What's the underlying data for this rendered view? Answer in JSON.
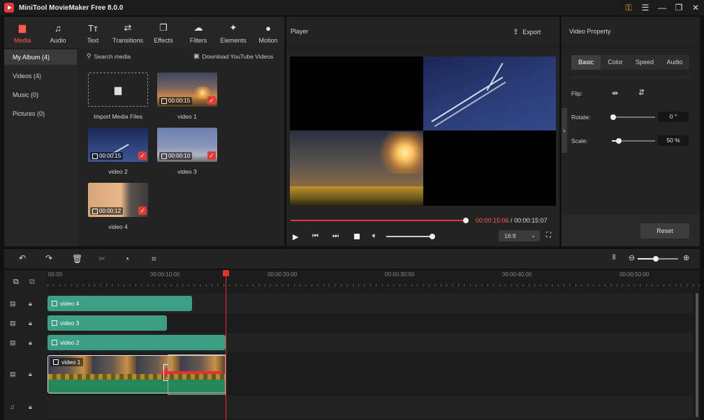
{
  "app": {
    "title": "MiniTool MovieMaker Free 8.0.0"
  },
  "toolbar": {
    "tabs": [
      {
        "label": "Media",
        "icon": "folder-icon",
        "glyph": "▆"
      },
      {
        "label": "Audio",
        "icon": "music-icon",
        "glyph": "♫"
      },
      {
        "label": "Text",
        "icon": "text-icon",
        "glyph": "Tт"
      },
      {
        "label": "Transitions",
        "icon": "transitions-icon",
        "glyph": "⇄"
      },
      {
        "label": "Effects",
        "icon": "effects-icon",
        "glyph": "❐"
      },
      {
        "label": "Filters",
        "icon": "filters-icon",
        "glyph": "☁"
      },
      {
        "label": "Elements",
        "icon": "elements-icon",
        "glyph": "✦"
      },
      {
        "label": "Motion",
        "icon": "motion-icon",
        "glyph": "●"
      }
    ]
  },
  "sidebar": {
    "items": [
      {
        "label": "My Album  (4)"
      },
      {
        "label": "Videos  (4)"
      },
      {
        "label": "Music  (0)"
      },
      {
        "label": "Pictures  (0)"
      }
    ]
  },
  "media": {
    "search_placeholder": "Search media",
    "download_label": "Download YouTube Videos",
    "import_label": "Import Media Files",
    "items": [
      {
        "name": "video 1",
        "duration": "00:00:15"
      },
      {
        "name": "video 2",
        "duration": "00:00:15"
      },
      {
        "name": "video 3",
        "duration": "00:00:10"
      },
      {
        "name": "video 4",
        "duration": "00:00:12"
      }
    ]
  },
  "player": {
    "title": "Player",
    "export_label": "Export",
    "current_time": "00:00:15:06",
    "separator": " / ",
    "total_time": "00:00:15:07",
    "aspect": "16:9",
    "progress": 1.0,
    "volume": 0.97
  },
  "properties": {
    "title": "Video Property",
    "tabs": [
      "Basic",
      "Color",
      "Speed",
      "Audio"
    ],
    "flip_label": "Flip:",
    "rotate_label": "Rotate:",
    "rotate_value": "0 °",
    "scale_label": "Scale:",
    "scale_value": "50 %",
    "reset_label": "Reset"
  },
  "timeline": {
    "ruler": [
      "00:00",
      "00:00:10:00",
      "00:00:20:00",
      "00:00:30:00",
      "00:00:40:00",
      "00:00:50:00"
    ],
    "clips": [
      {
        "label": "video 4"
      },
      {
        "label": "video 3"
      },
      {
        "label": "video 2"
      },
      {
        "label": "video 1"
      }
    ]
  },
  "colors": {
    "accent": "#ff5a4e",
    "clip": "#3c9e85",
    "playhead": "#e83030"
  }
}
